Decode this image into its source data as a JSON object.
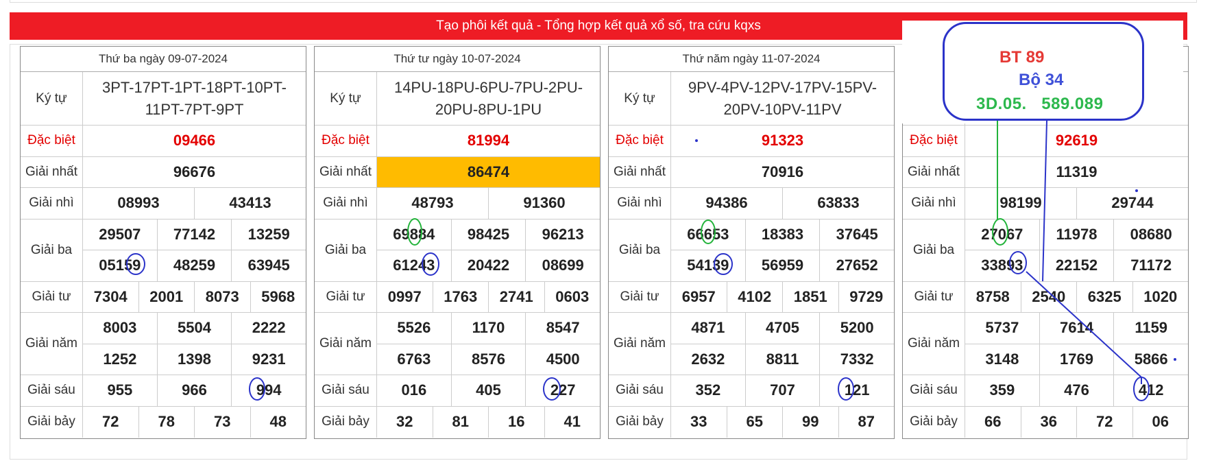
{
  "banner": {
    "title": "Tạo phôi kết quả - Tổng hợp kết quả xổ số, tra cứu kqxs"
  },
  "labels": {
    "kytu": "Ký tự",
    "db": "Đặc biệt",
    "nhat": "Giải nhất",
    "nhi": "Giải nhì",
    "ba": "Giải ba",
    "tu": "Giải tư",
    "nam": "Giải năm",
    "sau": "Giải sáu",
    "bay": "Giải bảy"
  },
  "days": [
    {
      "date": "Thứ ba ngày 09-07-2024",
      "kytu": "3PT-17PT-1PT-18PT-10PT-11PT-7PT-9PT",
      "db": "09466",
      "nhat": "96676",
      "nhi": [
        "08993",
        "43413"
      ],
      "ba": [
        "29507",
        "77142",
        "13259",
        "05159",
        "48259",
        "63945"
      ],
      "tu": [
        "7304",
        "2001",
        "8073",
        "5968"
      ],
      "nam": [
        "8003",
        "5504",
        "2222",
        "1252",
        "1398",
        "9231"
      ],
      "sau": [
        "955",
        "966",
        "994"
      ],
      "bay": [
        "72",
        "78",
        "73",
        "48"
      ]
    },
    {
      "date": "Thứ tư ngày 10-07-2024",
      "kytu": "14PU-18PU-6PU-7PU-2PU-20PU-8PU-1PU",
      "db": "81994",
      "nhat": "86474",
      "nhi": [
        "48793",
        "91360"
      ],
      "ba": [
        "69884",
        "98425",
        "96213",
        "61243",
        "20422",
        "08699"
      ],
      "tu": [
        "0997",
        "1763",
        "2741",
        "0603"
      ],
      "nam": [
        "5526",
        "1170",
        "8547",
        "6763",
        "8576",
        "4500"
      ],
      "sau": [
        "016",
        "405",
        "227"
      ],
      "bay": [
        "32",
        "81",
        "16",
        "41"
      ]
    },
    {
      "date": "Thứ năm ngày 11-07-2024",
      "kytu": "9PV-4PV-12PV-17PV-15PV-20PV-10PV-11PV",
      "db": "91323",
      "nhat": "70916",
      "nhi": [
        "94386",
        "63833"
      ],
      "ba": [
        "66653",
        "18383",
        "37645",
        "54139",
        "56959",
        "27652"
      ],
      "tu": [
        "6957",
        "4102",
        "1851",
        "9729"
      ],
      "nam": [
        "4871",
        "4705",
        "5200",
        "2632",
        "8811",
        "7332"
      ],
      "sau": [
        "352",
        "707",
        "121"
      ],
      "bay": [
        "33",
        "65",
        "99",
        "87"
      ]
    },
    {
      "date": "",
      "kytu": "",
      "db": "92619",
      "nhat": "11319",
      "nhi": [
        "98199",
        "29744"
      ],
      "ba": [
        "27067",
        "11978",
        "08680",
        "33893",
        "22152",
        "71172"
      ],
      "tu": [
        "8758",
        "2540",
        "6325",
        "1020"
      ],
      "nam": [
        "5737",
        "7614",
        "1159",
        "3148",
        "1769",
        "5866"
      ],
      "sau": [
        "359",
        "476",
        "412"
      ],
      "bay": [
        "66",
        "36",
        "72",
        "06"
      ]
    }
  ],
  "note": {
    "line1": "BT 89",
    "line2": "Bộ 34",
    "line3": "3D.05.   589.089"
  },
  "colors": {
    "banner": "#ee1c25",
    "special": "#e30000",
    "highlight": "#ffbb00",
    "note_red": "#e53935",
    "note_blue": "#3f51d8",
    "note_green": "#2db84d",
    "circle_blue": "#2b33c9",
    "circle_green": "#22b33a"
  }
}
